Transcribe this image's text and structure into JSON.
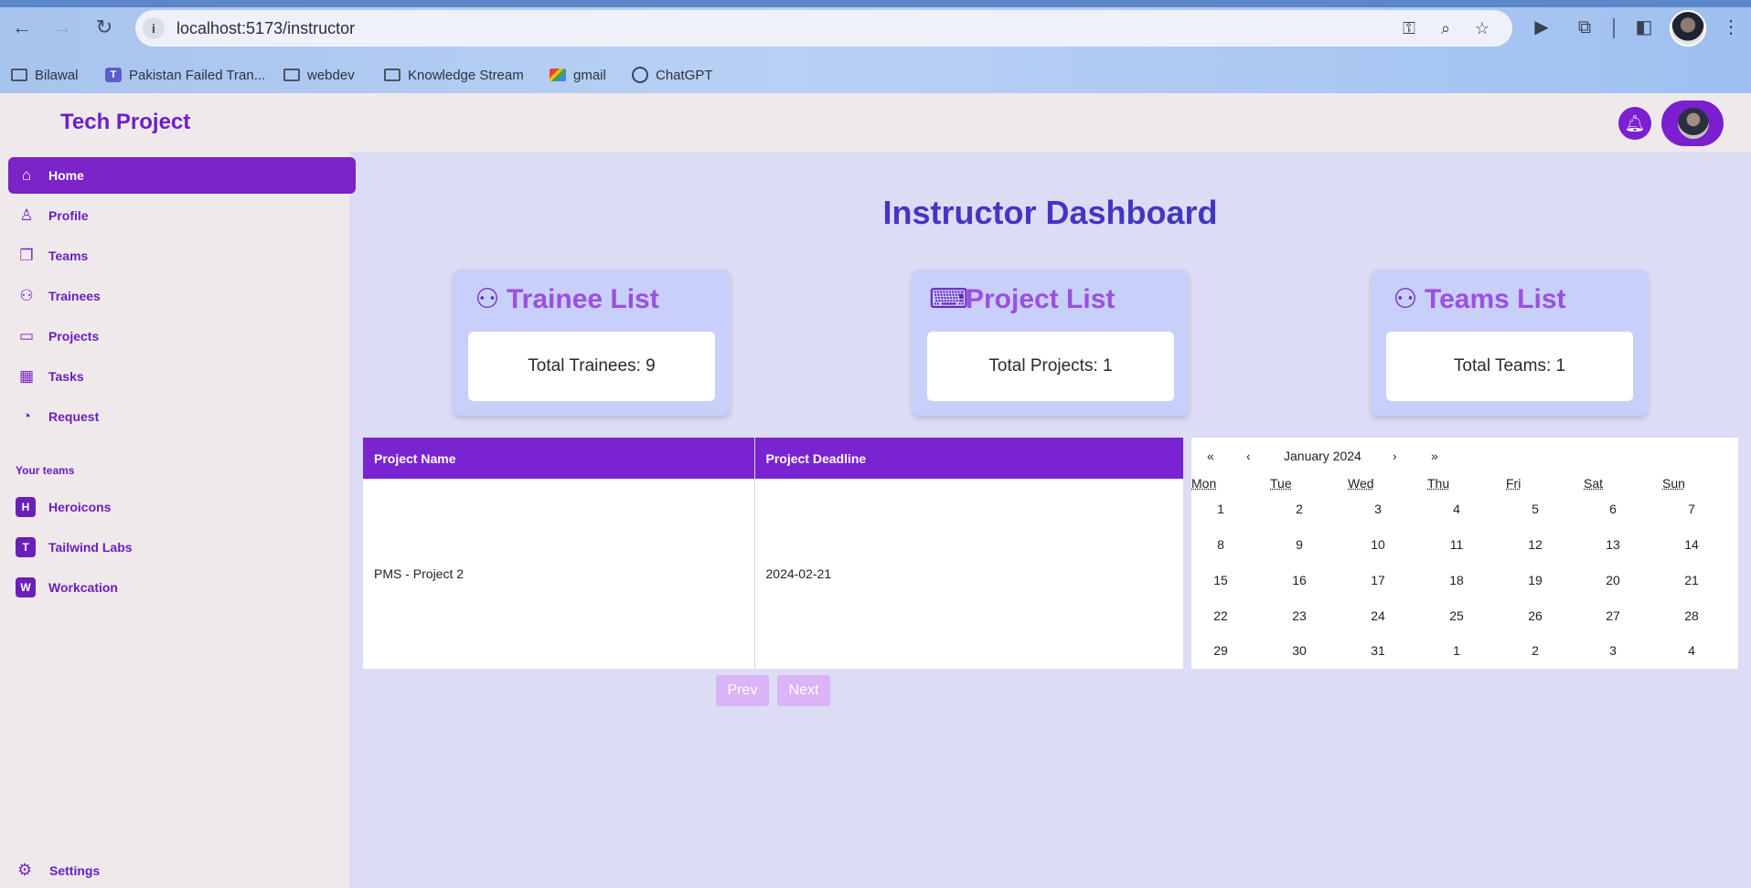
{
  "browser": {
    "url": "localhost:5173/instructor",
    "bookmarks": [
      "Bilawal",
      "Pakistan Failed Tran...",
      "webdev",
      "Knowledge Stream",
      "gmail",
      "ChatGPT"
    ]
  },
  "app": {
    "brand": "Tech Project",
    "sidebar": {
      "items": [
        {
          "label": "Home",
          "icon": "home-icon",
          "active": true
        },
        {
          "label": "Profile",
          "icon": "user-icon",
          "active": false
        },
        {
          "label": "Teams",
          "icon": "documents-icon",
          "active": false
        },
        {
          "label": "Trainees",
          "icon": "users-icon",
          "active": false
        },
        {
          "label": "Projects",
          "icon": "folder-icon",
          "active": false
        },
        {
          "label": "Tasks",
          "icon": "calendar-icon",
          "active": false
        },
        {
          "label": "Request",
          "icon": "chart-pie-icon",
          "active": false
        }
      ],
      "teams_title": "Your teams",
      "teams": [
        {
          "initial": "H",
          "label": "Heroicons"
        },
        {
          "initial": "T",
          "label": "Tailwind Labs"
        },
        {
          "initial": "W",
          "label": "Workcation"
        }
      ],
      "settings_label": "Settings"
    }
  },
  "main": {
    "title": "Instructor Dashboard",
    "cards": [
      {
        "title": "Trainee List",
        "text": "Total Trainees: 9",
        "icon": "users-icon"
      },
      {
        "title": "Project List",
        "text": "Total Projects: 1",
        "icon": "terminal-icon"
      },
      {
        "title": "Teams List",
        "text": "Total Teams: 1",
        "icon": "users-icon"
      }
    ],
    "table": {
      "headers": [
        "Project Name",
        "Project Deadline"
      ],
      "rows": [
        [
          "PMS - Project 2",
          "2024-02-21"
        ]
      ]
    },
    "pager": {
      "prev": "Prev",
      "next": "Next"
    },
    "calendar": {
      "first": "«",
      "prev": "‹",
      "month": "January 2024",
      "next": "›",
      "last": "»",
      "dow": [
        "Mon",
        "Tue",
        "Wed",
        "Thu",
        "Fri",
        "Sat",
        "Sun"
      ],
      "weeks": [
        [
          "1",
          "2",
          "3",
          "4",
          "5",
          "6",
          "7"
        ],
        [
          "8",
          "9",
          "10",
          "11",
          "12",
          "13",
          "14"
        ],
        [
          "15",
          "16",
          "17",
          "18",
          "19",
          "20",
          "21"
        ],
        [
          "22",
          "23",
          "24",
          "25",
          "26",
          "27",
          "28"
        ],
        [
          "29",
          "30",
          "31",
          "1",
          "2",
          "3",
          "4"
        ]
      ]
    }
  },
  "colors": {
    "accent": "#7a23c6",
    "title": "#4336c3",
    "card_bg": "#c8cff8",
    "main_bg": "#dcdcf4"
  }
}
